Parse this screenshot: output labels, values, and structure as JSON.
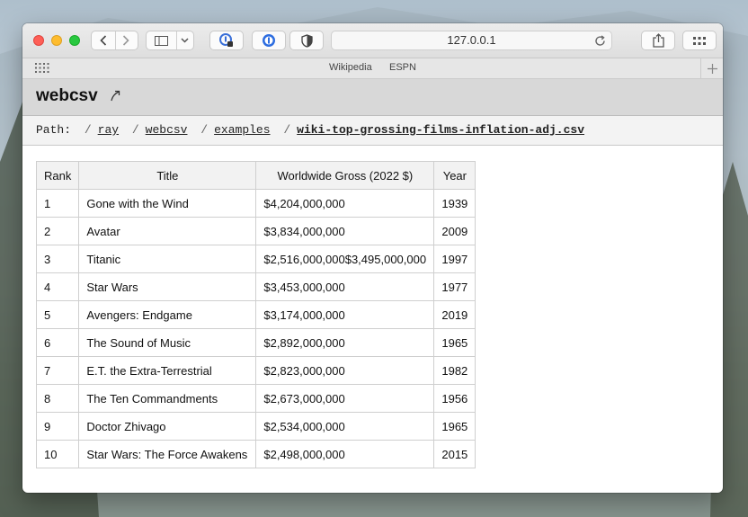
{
  "browser": {
    "address": "127.0.0.1",
    "favorites": [
      "Wikipedia",
      "ESPN"
    ]
  },
  "page": {
    "title": "webcsv",
    "path_label": "Path:",
    "path": [
      {
        "label": "ray"
      },
      {
        "label": "webcsv"
      },
      {
        "label": "examples"
      },
      {
        "label": "wiki-top-grossing-films-inflation-adj.csv"
      }
    ]
  },
  "table": {
    "headers": [
      "Rank",
      "Title",
      "Worldwide Gross (2022 $)",
      "Year"
    ],
    "rows": [
      [
        "1",
        "Gone with the Wind",
        "$4,204,000,000",
        "1939"
      ],
      [
        "2",
        "Avatar",
        "$3,834,000,000",
        "2009"
      ],
      [
        "3",
        "Titanic",
        "$2,516,000,000$3,495,000,000",
        "1997"
      ],
      [
        "4",
        "Star Wars",
        "$3,453,000,000",
        "1977"
      ],
      [
        "5",
        "Avengers: Endgame",
        "$3,174,000,000",
        "2019"
      ],
      [
        "6",
        "The Sound of Music",
        "$2,892,000,000",
        "1965"
      ],
      [
        "7",
        "E.T. the Extra-Terrestrial",
        "$2,823,000,000",
        "1982"
      ],
      [
        "8",
        "The Ten Commandments",
        "$2,673,000,000",
        "1956"
      ],
      [
        "9",
        "Doctor Zhivago",
        "$2,534,000,000",
        "1965"
      ],
      [
        "10",
        "Star Wars: The Force Awakens",
        "$2,498,000,000",
        "2015"
      ]
    ]
  },
  "icons": {
    "back": "chevron-left-icon",
    "forward": "chevron-right-icon",
    "sidebar": "sidebar-icon",
    "password": "password-manager-icon",
    "onepassword": "onepassword-icon",
    "privacy": "shield-icon",
    "reload": "reload-icon",
    "share": "share-icon",
    "tabs": "tab-overview-icon",
    "title_link": "external-link-arrow-icon"
  }
}
